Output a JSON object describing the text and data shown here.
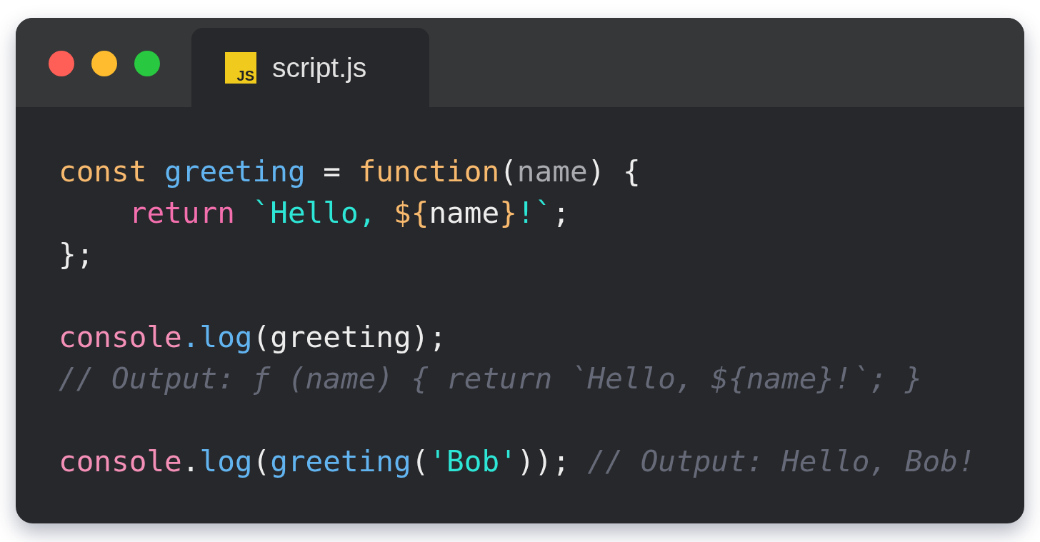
{
  "window": {
    "tab": {
      "icon_text": "JS",
      "title": "script.js"
    }
  },
  "code": {
    "lines": [
      {
        "kind": "code",
        "tokens": [
          {
            "text": "const ",
            "kind": "keyword"
          },
          {
            "text": "greeting",
            "kind": "name"
          },
          {
            "text": " = ",
            "kind": "plain"
          },
          {
            "text": "function",
            "kind": "keyword"
          },
          {
            "text": "(",
            "kind": "plain"
          },
          {
            "text": "name",
            "kind": "param"
          },
          {
            "text": ") {",
            "kind": "plain"
          }
        ]
      },
      {
        "kind": "code",
        "tokens": [
          {
            "text": "    return ",
            "kind": "control"
          },
          {
            "text": "`Hello, ",
            "kind": "string"
          },
          {
            "text": "${",
            "kind": "keyword"
          },
          {
            "text": "name",
            "kind": "plain"
          },
          {
            "text": "}",
            "kind": "keyword"
          },
          {
            "text": "!`",
            "kind": "string"
          },
          {
            "text": ";",
            "kind": "plain"
          }
        ]
      },
      {
        "kind": "code",
        "tokens": [
          {
            "text": "};",
            "kind": "plain"
          }
        ]
      },
      {
        "kind": "blank"
      },
      {
        "kind": "code",
        "tokens": [
          {
            "text": "console",
            "kind": "object"
          },
          {
            "text": ".log",
            "kind": "name"
          },
          {
            "text": "(greeting);",
            "kind": "plain"
          }
        ]
      },
      {
        "kind": "code",
        "tokens": [
          {
            "text": "// Output: ƒ (name) { return `Hello, ${name}!`; }",
            "kind": "comment"
          }
        ]
      },
      {
        "kind": "blank"
      },
      {
        "kind": "code",
        "tokens": [
          {
            "text": "console",
            "kind": "object"
          },
          {
            "text": ".",
            "kind": "plain"
          },
          {
            "text": "log",
            "kind": "name"
          },
          {
            "text": "(",
            "kind": "plain"
          },
          {
            "text": "greeting",
            "kind": "name"
          },
          {
            "text": "(",
            "kind": "plain"
          },
          {
            "text": "'Bob'",
            "kind": "string"
          },
          {
            "text": ")); ",
            "kind": "plain"
          },
          {
            "text": "// Output: Hello, Bob!",
            "kind": "comment"
          }
        ]
      }
    ]
  }
}
